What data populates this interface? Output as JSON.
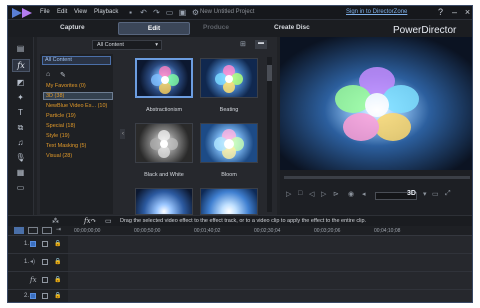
{
  "menu": [
    "File",
    "Edit",
    "View",
    "Playback"
  ],
  "project_title": "New Untitled Project",
  "sign_in": "Sign in to DirectorZone",
  "modes": {
    "capture": "Capture",
    "edit": "Edit",
    "produce": "Produce",
    "create_disc": "Create Disc"
  },
  "library": {
    "filter": "All Content",
    "categories_header": "All Content",
    "categories": [
      "My Favorites  (0)",
      "3D  (38)",
      "NewBlue Video Es... (10)",
      "Particle  (19)",
      "Special  (18)",
      "Style  (19)",
      "Text Masking  (5)",
      "Visual  (28)"
    ],
    "thumbnails": [
      {
        "caption": "Abstractionism"
      },
      {
        "caption": "Beating"
      },
      {
        "caption": "Black and White"
      },
      {
        "caption": "Bloom"
      }
    ]
  },
  "preview": {
    "brand": "PowerDirector",
    "mode_3d": "3D"
  },
  "infobar": {
    "hint": "Drag the selected video effect to the effect track, or to a video clip to apply the effect to the entire clip."
  },
  "timeline": {
    "ruler": [
      "00;00;00;00",
      "00;00;50;00",
      "00;01;40;02",
      "00;02;30;04",
      "00;03;20;06",
      "00;04;10;08"
    ],
    "tracks": [
      {
        "label": "1."
      },
      {
        "label": "1."
      },
      {
        "label": "fx"
      },
      {
        "label": "2."
      }
    ]
  }
}
